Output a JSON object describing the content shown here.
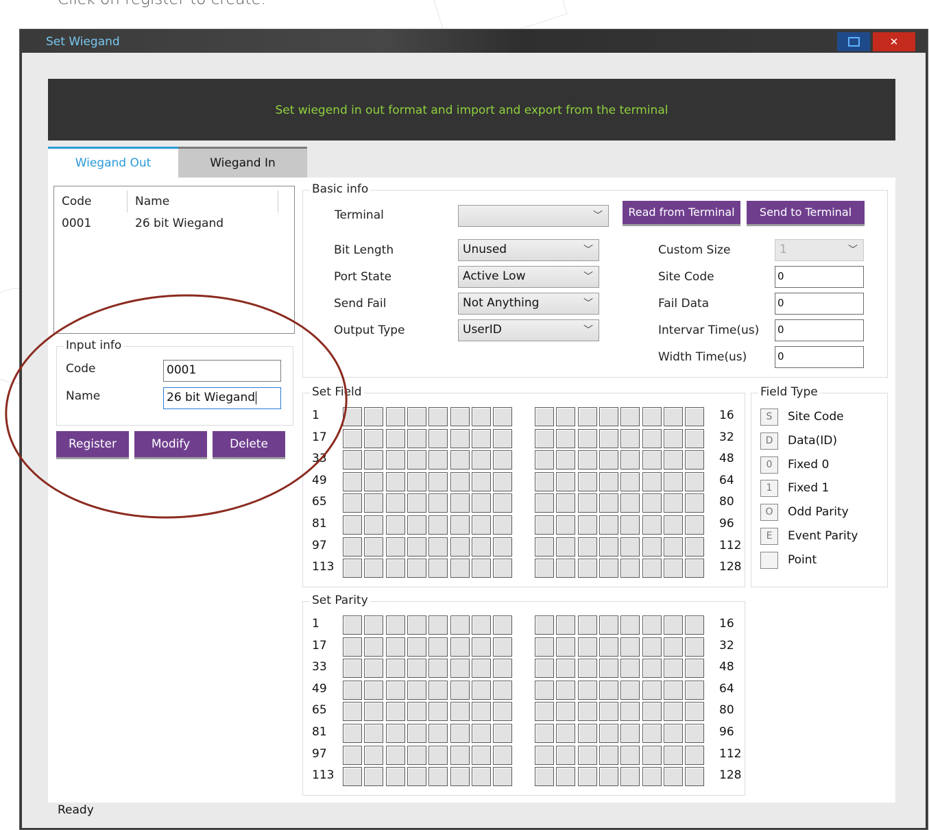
{
  "caption": "Click on register to create.",
  "window": {
    "title": "Set Wiegand",
    "close_glyph": "✕"
  },
  "header": {
    "text": "Set wiegend in  out format and import and export from the terminal"
  },
  "tabs": [
    {
      "label": "Wiegand Out",
      "active": true
    },
    {
      "label": "Wiegand In",
      "active": false
    }
  ],
  "list": {
    "columns": [
      "Code",
      "Name"
    ],
    "rows": [
      {
        "code": "0001",
        "name": "26 bit Wiegand"
      }
    ]
  },
  "input_info": {
    "title": "Input info",
    "code_label": "Code",
    "code_value": "0001",
    "name_label": "Name",
    "name_value": "26 bit Wiegand"
  },
  "actions": {
    "register": "Register",
    "modify": "Modify",
    "delete": "Delete"
  },
  "basic_info": {
    "title": "Basic info",
    "terminal_label": "Terminal",
    "terminal_value": "",
    "read_button": "Read from Terminal",
    "send_button": "Send to Terminal",
    "bit_length_label": "Bit Length",
    "bit_length_value": "Unused",
    "port_state_label": "Port State",
    "port_state_value": "Active Low",
    "send_fail_label": "Send Fail",
    "send_fail_value": "Not Anything",
    "output_type_label": "Output Type",
    "output_type_value": "UserID",
    "custom_size_label": "Custom Size",
    "custom_size_value": "1",
    "site_code_label": "Site Code",
    "site_code_value": "0",
    "fail_data_label": "Fail Data",
    "fail_data_value": "0",
    "intervar_label": "Intervar Time(us)",
    "intervar_value": "0",
    "width_label": "Width Time(us)",
    "width_value": "0"
  },
  "set_field": {
    "title": "Set Field",
    "left_rows": [
      "1",
      "17",
      "33",
      "49",
      "65",
      "81",
      "97",
      "113"
    ],
    "right_rows": [
      "16",
      "32",
      "48",
      "64",
      "80",
      "96",
      "112",
      "128"
    ]
  },
  "set_parity": {
    "title": "Set Parity",
    "left_rows": [
      "1",
      "17",
      "33",
      "49",
      "65",
      "81",
      "97",
      "113"
    ],
    "right_rows": [
      "16",
      "32",
      "48",
      "64",
      "80",
      "96",
      "112",
      "128"
    ]
  },
  "field_type": {
    "title": "Field Type",
    "items": [
      {
        "code": "S",
        "label": "Site Code"
      },
      {
        "code": "D",
        "label": "Data(ID)"
      },
      {
        "code": "0",
        "label": "Fixed 0"
      },
      {
        "code": "1",
        "label": "Fixed 1"
      },
      {
        "code": "O",
        "label": "Odd Parity"
      },
      {
        "code": "E",
        "label": "Event Parity"
      },
      {
        "code": "",
        "label": "Point"
      }
    ]
  },
  "status": {
    "text": "Ready"
  },
  "colors": {
    "accent": "#2a9ad8",
    "button": "#6f3f8e",
    "header_bg": "#333333",
    "header_text": "#8fd13e",
    "annotation": "#8b2a1f"
  }
}
